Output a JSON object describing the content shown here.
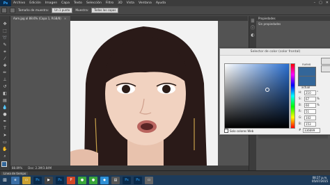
{
  "app": {
    "logo": "Ps"
  },
  "menu": [
    "Archivo",
    "Edición",
    "Imagen",
    "Capa",
    "Texto",
    "Selección",
    "Filtro",
    "3D",
    "Vista",
    "Ventana",
    "Ayuda"
  ],
  "window_controls": {
    "minimize": "–",
    "maximize": "▢",
    "close": "✕"
  },
  "options_bar": {
    "sample_label": "Tamaño de muestra:",
    "sample_value": "Un 1 punto",
    "muestra_label": "Muestra:",
    "muestra_value": "Todas las capas"
  },
  "document_tab": {
    "title": "Aam.jpg al 88.6% (Capa 1, RGB/8)",
    "close": "×"
  },
  "status_bar": {
    "zoom": "88.89%",
    "doc": "Doc: 2.3M/3.84M"
  },
  "timeline": {
    "label": "Línea de tiempo"
  },
  "right_panel": {
    "header": "Propiedades",
    "sub": "Sin propiedades"
  },
  "color_picker": {
    "title": "Selector de color (color frontal)",
    "new_label": "nuevo",
    "current_label": "actual",
    "web_only_label": "Solo colores Web",
    "fields": [
      {
        "label": "H:",
        "value": "210",
        "unit": "°"
      },
      {
        "label": "S:",
        "value": "67",
        "unit": "%"
      },
      {
        "label": "B:",
        "value": "60",
        "unit": "%"
      },
      {
        "label": "R:",
        "value": "51",
        "unit": ""
      },
      {
        "label": "G:",
        "value": "102",
        "unit": ""
      },
      {
        "label": "B:",
        "value": "153",
        "unit": ""
      }
    ],
    "hex_label": "#",
    "hex": "336699",
    "new_color": "#336699"
  },
  "clock": {
    "time": "08:27 p.m.",
    "date": "05/07/2015"
  }
}
